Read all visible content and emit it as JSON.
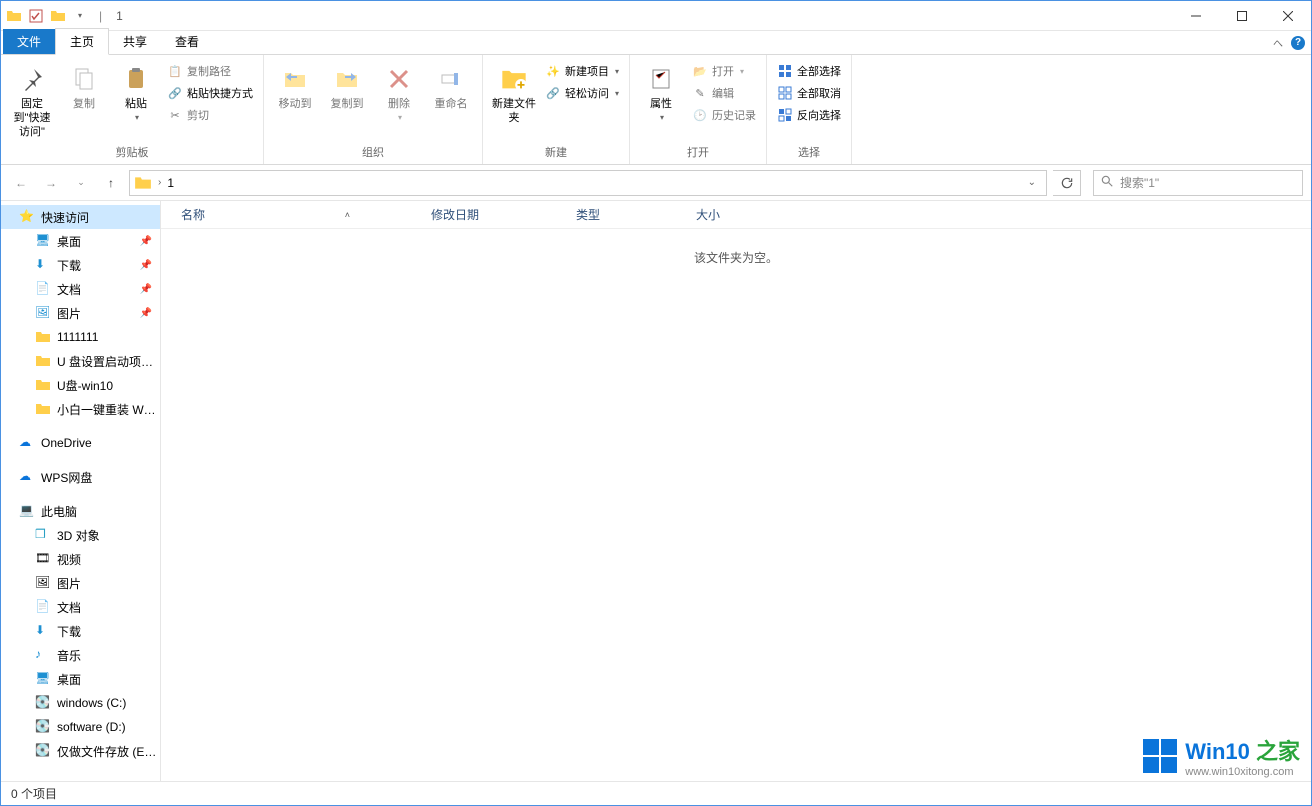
{
  "title": "1",
  "qat_separator": "|",
  "tabs": {
    "file": "文件",
    "home": "主页",
    "share": "共享",
    "view": "查看"
  },
  "ribbon": {
    "group_clipboard": "剪贴板",
    "pin_quick_access": "固定到\"快速访问\"",
    "copy": "复制",
    "paste": "粘贴",
    "copy_path": "复制路径",
    "paste_shortcut": "粘贴快捷方式",
    "cut": "剪切",
    "group_organize": "组织",
    "move_to": "移动到",
    "copy_to": "复制到",
    "delete": "删除",
    "rename": "重命名",
    "group_new": "新建",
    "new_folder": "新建文件夹",
    "new_item": "新建项目",
    "easy_access": "轻松访问",
    "group_open": "打开",
    "properties": "属性",
    "open": "打开",
    "edit": "编辑",
    "history": "历史记录",
    "group_select": "选择",
    "select_all": "全部选择",
    "select_none": "全部取消",
    "invert_sel": "反向选择"
  },
  "nav": {
    "breadcrumb": "1",
    "refresh_tip": "↻",
    "search_placeholder": "搜索\"1\""
  },
  "columns": {
    "name": "名称",
    "date": "修改日期",
    "type": "类型",
    "size": "大小"
  },
  "empty_text": "该文件夹为空。",
  "tree": {
    "quick_access": "快速访问",
    "desktop": "桌面",
    "downloads": "下载",
    "documents": "文档",
    "pictures": "图片",
    "f1": "1111111",
    "f2": "U 盘设置启动项…",
    "f3": "U盘-win10",
    "f4": "小白一键重装 W…",
    "onedrive": "OneDrive",
    "wps": "WPS网盘",
    "this_pc": "此电脑",
    "obj3d": "3D 对象",
    "videos": "视频",
    "pictures2": "图片",
    "documents2": "文档",
    "downloads2": "下载",
    "music": "音乐",
    "desktop2": "桌面",
    "drive_c": "windows (C:)",
    "drive_d": "software (D:)",
    "drive_e": "仅做文件存放 (E…"
  },
  "status": "0 个项目",
  "watermark": {
    "title_a": "Win10",
    "title_b": "之家",
    "url": "www.win10xitong.com"
  }
}
